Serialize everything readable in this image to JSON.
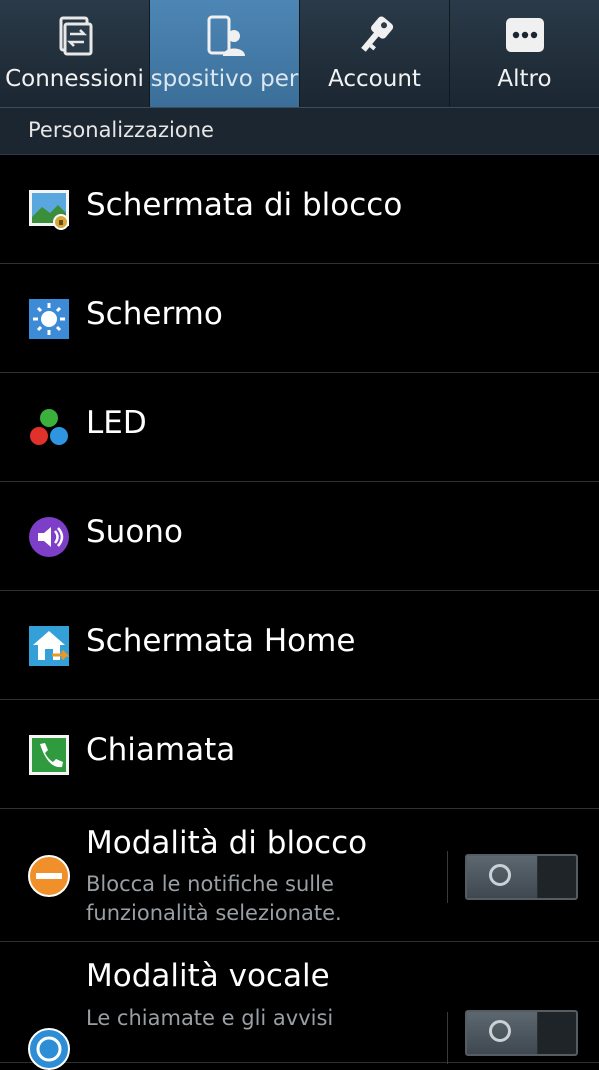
{
  "tabs": [
    {
      "label": "Connessioni",
      "icon": "connections-icon",
      "active": false
    },
    {
      "label": "spositivo per",
      "icon": "device-person-icon",
      "active": true
    },
    {
      "label": "Account",
      "icon": "key-icon",
      "active": false
    },
    {
      "label": "Altro",
      "icon": "more-icon",
      "active": false
    }
  ],
  "section": {
    "title": "Personalizzazione"
  },
  "items": [
    {
      "label": "Schermata di blocco",
      "icon": "lockscreen-icon"
    },
    {
      "label": "Schermo",
      "icon": "display-brightness-icon"
    },
    {
      "label": "LED",
      "icon": "led-icon"
    },
    {
      "label": "Suono",
      "icon": "sound-icon"
    },
    {
      "label": "Schermata Home",
      "icon": "home-screen-icon"
    },
    {
      "label": "Chiamata",
      "icon": "phone-call-icon"
    },
    {
      "label": "Modalità di blocco",
      "sub": "Blocca le notifiche sulle funzionalità selezionate.",
      "icon": "blocking-mode-icon",
      "toggle": "off"
    },
    {
      "label": "Modalità vocale",
      "sub": "Le chiamate e gli avvisi",
      "icon": "driving-mode-icon",
      "toggle": "off"
    }
  ],
  "colors": {
    "tab_active": "#4d86b5",
    "background": "#000000",
    "header_bg": "#1c2630"
  }
}
